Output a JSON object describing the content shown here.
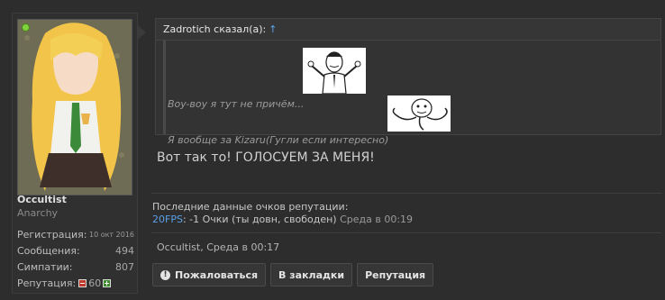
{
  "user": {
    "name": "Occultist",
    "title": "Anarchy",
    "stats": [
      {
        "label": "Регистрация:",
        "value": "10 окт 2016"
      },
      {
        "label": "Сообщения:",
        "value": "494"
      },
      {
        "label": "Симпатии:",
        "value": "807"
      },
      {
        "label": "Репутация:",
        "value": "60"
      }
    ]
  },
  "quote": {
    "author": "Zadrotich сказал(а):",
    "arrow": "↑",
    "line1": "Boy-воу я тут не причём...",
    "line2": "Я вообще за Kizaru(Гугли если интересно)"
  },
  "message": "Вот так то! ГОЛОСУЕМ ЗА МЕНЯ!",
  "reputation": {
    "title": "Последние данные очков репутации:",
    "user": "20FPS",
    "text": ": -1 Очки (ты довн, свободен)",
    "date": "Среда в 00:19"
  },
  "post_meta": "Occultist, Среда в 00:17",
  "actions": {
    "report": "Пожаловаться",
    "bookmark": "В закладки",
    "reputation": "Репутация"
  },
  "colors": {
    "background": "#2d2d2d",
    "link": "#5aa0e8",
    "online": "#7fd23b"
  }
}
